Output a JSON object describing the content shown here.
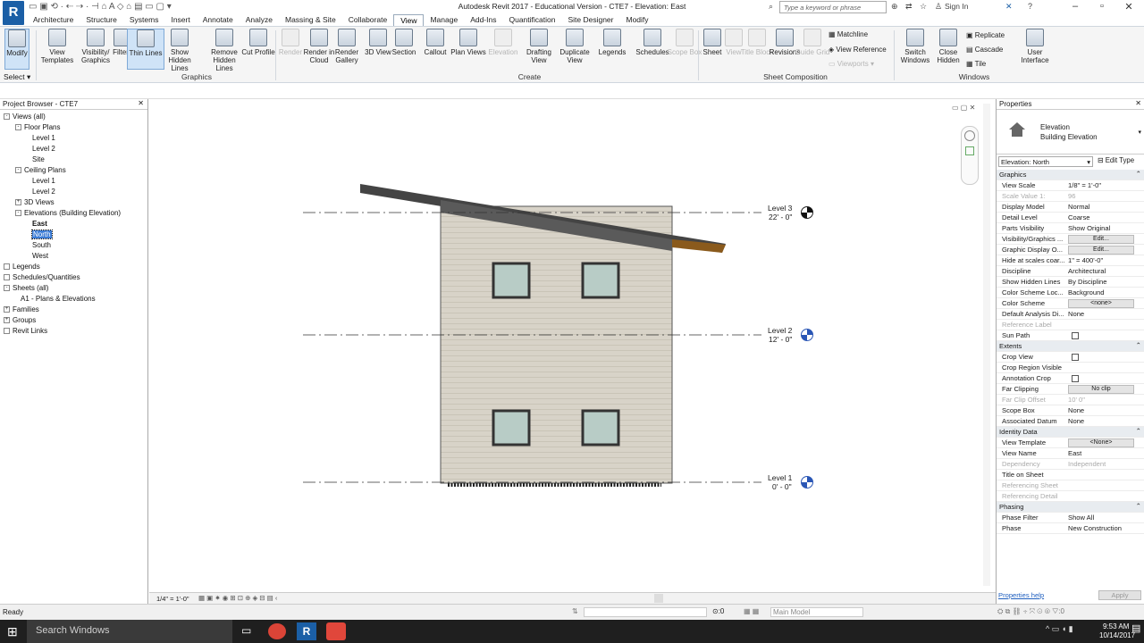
{
  "window": {
    "title": "Autodesk Revit 2017 - Educational Version -  CTE7 - Elevation: East",
    "logo": "R",
    "search_placeholder": "Type a keyword or phrase",
    "sign_in": "Sign In"
  },
  "tabs": [
    "Architecture",
    "Structure",
    "Systems",
    "Insert",
    "Annotate",
    "Analyze",
    "Massing & Site",
    "Collaborate",
    "View",
    "Manage",
    "Add-Ins",
    "Quantification",
    "Site Designer",
    "Modify"
  ],
  "active_tab": "View",
  "ribbon": {
    "modify": "Modify",
    "select": "Select",
    "graphics": {
      "label": "Graphics",
      "buttons": [
        "View Templates",
        "Visibility/ Graphics",
        "Filters",
        "Thin Lines",
        "Show Hidden Lines",
        "Remove Hidden Lines",
        "Cut Profile"
      ]
    },
    "presentation": {
      "buttons": [
        "Render",
        "Render in Cloud",
        "Render Gallery"
      ]
    },
    "create": {
      "label": "Create",
      "buttons": [
        "3D View",
        "Section",
        "Callout",
        "Plan Views",
        "Elevation",
        "Drafting View",
        "Duplicate View",
        "Legends",
        "Schedules",
        "Scope Box"
      ]
    },
    "sheet": {
      "label": "Sheet Composition",
      "buttons": [
        "Sheet",
        "View",
        "Title Block",
        "Revisions",
        "Guide Grid"
      ],
      "small": [
        "Matchline",
        "View Reference",
        "Viewports"
      ]
    },
    "windows": {
      "label": "Windows",
      "buttons": [
        "Switch Windows",
        "Close Hidden"
      ],
      "small": [
        "Replicate",
        "Cascade",
        "Tile"
      ],
      "ui": "User Interface"
    }
  },
  "project_browser": {
    "title": "Project Browser - CTE7",
    "rows": [
      {
        "label": "Views (all)",
        "level": 0,
        "tog": "-"
      },
      {
        "label": "Floor Plans",
        "level": 1,
        "tog": "-"
      },
      {
        "label": "Level 1",
        "level": 2
      },
      {
        "label": "Level 2",
        "level": 2
      },
      {
        "label": "Site",
        "level": 2
      },
      {
        "label": "Ceiling Plans",
        "level": 1,
        "tog": "-"
      },
      {
        "label": "Level 1",
        "level": 2
      },
      {
        "label": "Level 2",
        "level": 2
      },
      {
        "label": "3D Views",
        "level": 1,
        "tog": "+"
      },
      {
        "label": "Elevations (Building Elevation)",
        "level": 1,
        "tog": "-"
      },
      {
        "label": "East",
        "level": 2,
        "bold": true
      },
      {
        "label": "North",
        "level": 2,
        "selected": true
      },
      {
        "label": "South",
        "level": 2
      },
      {
        "label": "West",
        "level": 2
      },
      {
        "label": "Legends",
        "level": 0,
        "tog": ""
      },
      {
        "label": "Schedules/Quantities",
        "level": 0,
        "tog": ""
      },
      {
        "label": "Sheets (all)",
        "level": 0,
        "tog": "-"
      },
      {
        "label": "A1 - Plans & Elevations",
        "level": 1
      },
      {
        "label": "Families",
        "level": 0,
        "tog": "+"
      },
      {
        "label": "Groups",
        "level": 0,
        "tog": "+"
      },
      {
        "label": "Revit Links",
        "level": 0,
        "tog": ""
      }
    ]
  },
  "canvas": {
    "levels": [
      {
        "name": "Level 3",
        "elev": "22' - 0\""
      },
      {
        "name": "Level 2",
        "elev": "12' - 0\""
      },
      {
        "name": "Level 1",
        "elev": "0' - 0\""
      }
    ],
    "view_scale_label": "1/4\" = 1'-0\""
  },
  "properties": {
    "title": "Properties",
    "family": "Elevation",
    "type": "Building Elevation",
    "instance": "Elevation: North",
    "edit_type": "Edit Type",
    "rows": [
      {
        "k": "Graphics",
        "grp": true
      },
      {
        "k": "View Scale",
        "v": "1/8\" = 1'-0\""
      },
      {
        "k": "Scale Value    1:",
        "v": "96",
        "dim": true
      },
      {
        "k": "Display Model",
        "v": "Normal"
      },
      {
        "k": "Detail Level",
        "v": "Coarse"
      },
      {
        "k": "Parts Visibility",
        "v": "Show Original"
      },
      {
        "k": "Visibility/Graphics ...",
        "btn": "Edit..."
      },
      {
        "k": "Graphic Display O...",
        "btn": "Edit..."
      },
      {
        "k": "Hide at scales coar...",
        "v": "1\" = 400'-0\""
      },
      {
        "k": "Discipline",
        "v": "Architectural"
      },
      {
        "k": "Show Hidden Lines",
        "v": "By Discipline"
      },
      {
        "k": "Color Scheme Loc...",
        "v": "Background"
      },
      {
        "k": "Color Scheme",
        "btn": "<none>"
      },
      {
        "k": "Default Analysis Di...",
        "v": "None"
      },
      {
        "k": "Reference Label",
        "v": "",
        "dim": true
      },
      {
        "k": "Sun Path",
        "chk": true
      },
      {
        "k": "Extents",
        "grp": true
      },
      {
        "k": "Crop View",
        "chk": true
      },
      {
        "k": "Crop Region Visible",
        "v": ""
      },
      {
        "k": "Annotation Crop",
        "chk": true
      },
      {
        "k": "Far Clipping",
        "btn": "No clip"
      },
      {
        "k": "Far Clip Offset",
        "v": "10' 0\"",
        "dim": true
      },
      {
        "k": "Scope Box",
        "v": "None"
      },
      {
        "k": "Associated Datum",
        "v": "None"
      },
      {
        "k": "Identity Data",
        "grp": true
      },
      {
        "k": "View Template",
        "btn": "<None>"
      },
      {
        "k": "View Name",
        "v": "East"
      },
      {
        "k": "Dependency",
        "v": "Independent",
        "dim": true
      },
      {
        "k": "Title on Sheet",
        "v": ""
      },
      {
        "k": "Referencing Sheet",
        "v": "",
        "dim": true
      },
      {
        "k": "Referencing Detail",
        "v": "",
        "dim": true
      },
      {
        "k": "Phasing",
        "grp": true
      },
      {
        "k": "Phase Filter",
        "v": "Show All"
      },
      {
        "k": "Phase",
        "v": "New Construction"
      }
    ],
    "help": "Properties help",
    "apply": "Apply"
  },
  "status": {
    "left": "Ready",
    "model": "Main Model",
    "coord": ":0"
  },
  "taskbar": {
    "search": "Search Windows",
    "time": "9:53 AM",
    "date": "10/14/2017"
  }
}
